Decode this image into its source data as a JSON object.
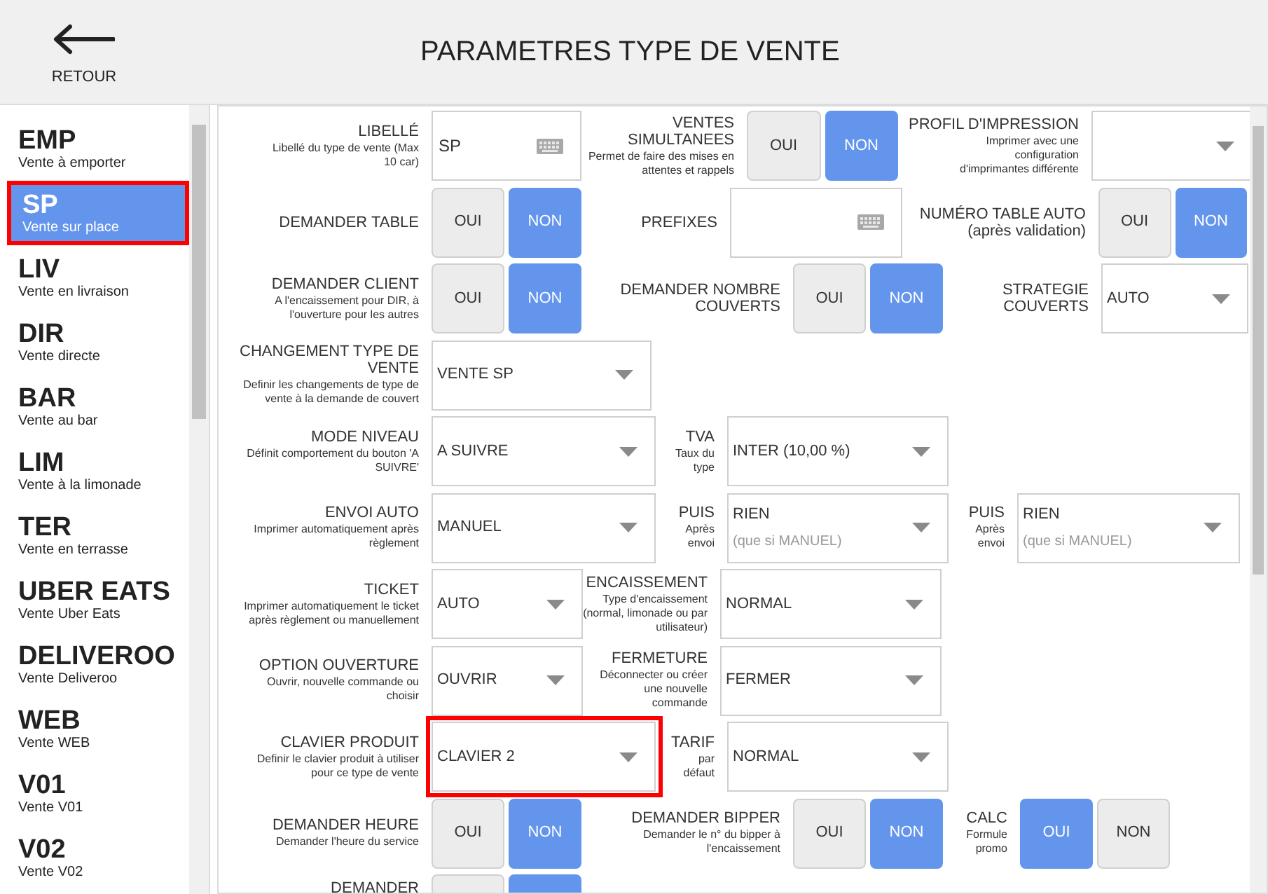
{
  "header": {
    "back_label": "RETOUR",
    "title": "PARAMETRES TYPE DE VENTE"
  },
  "sidebar": {
    "items": [
      {
        "code": "EMP",
        "name": "Vente à emporter",
        "selected": false,
        "highlighted": false
      },
      {
        "code": "SP",
        "name": "Vente sur place",
        "selected": true,
        "highlighted": true
      },
      {
        "code": "LIV",
        "name": "Vente en livraison",
        "selected": false,
        "highlighted": false
      },
      {
        "code": "DIR",
        "name": "Vente directe",
        "selected": false,
        "highlighted": false
      },
      {
        "code": "BAR",
        "name": "Vente au bar",
        "selected": false,
        "highlighted": false
      },
      {
        "code": "LIM",
        "name": "Vente à la limonade",
        "selected": false,
        "highlighted": false
      },
      {
        "code": "TER",
        "name": "Vente en terrasse",
        "selected": false,
        "highlighted": false
      },
      {
        "code": "UBER EATS",
        "name": "Vente Uber Eats",
        "selected": false,
        "highlighted": false
      },
      {
        "code": "DELIVEROO",
        "name": "Vente Deliveroo",
        "selected": false,
        "highlighted": false
      },
      {
        "code": "WEB",
        "name": "Vente WEB",
        "selected": false,
        "highlighted": false
      },
      {
        "code": "V01",
        "name": "Vente V01",
        "selected": false,
        "highlighted": false
      },
      {
        "code": "V02",
        "name": "Vente V02",
        "selected": false,
        "highlighted": false
      }
    ]
  },
  "form": {
    "rows": [
      [
        {
          "kind": "text",
          "label": "LIBELLÉ",
          "hint": "Libellé du type de vente (Max 10 car)",
          "value": "SP"
        },
        {
          "kind": "toggle",
          "label": "VENTES SIMULTANEES",
          "hint": "Permet de faire des mises en attentes et rappels",
          "options": [
            {
              "text": "OUI",
              "selected": false
            },
            {
              "text": "NON",
              "selected": true
            }
          ]
        },
        {
          "kind": "select",
          "label": "PROFIL D'IMPRESSION",
          "hint": "Imprimer avec une configuration d'imprimantes différente"
        }
      ],
      [
        {
          "kind": "toggle",
          "label": "DEMANDER TABLE",
          "options": [
            {
              "text": "OUI",
              "selected": false
            },
            {
              "text": "NON",
              "selected": true
            }
          ]
        },
        {
          "kind": "text",
          "label": "PREFIXES"
        },
        {
          "kind": "toggle",
          "label": "NUMÉRO TABLE AUTO",
          "sublabel": "(après validation)",
          "options": [
            {
              "text": "OUI",
              "selected": false
            },
            {
              "text": "NON",
              "selected": true
            }
          ]
        }
      ],
      [
        {
          "kind": "toggle",
          "label": "DEMANDER CLIENT",
          "hint": "A l'encaissement pour DIR, à l'ouverture pour les autres",
          "options": [
            {
              "text": "OUI",
              "selected": false
            },
            {
              "text": "NON",
              "selected": true
            }
          ]
        },
        {
          "kind": "toggle",
          "label": "DEMANDER NOMBRE COUVERTS",
          "options": [
            {
              "text": "OUI",
              "selected": false
            },
            {
              "text": "NON",
              "selected": true
            }
          ]
        },
        {
          "kind": "select",
          "label": "STRATEGIE COUVERTS",
          "value": "AUTO"
        }
      ],
      [
        {
          "kind": "select",
          "label": "CHANGEMENT TYPE DE VENTE",
          "hint": "Definir les changements de type de vente à la demande de couvert",
          "value": "VENTE SP"
        }
      ],
      [
        {
          "kind": "select",
          "label": "MODE NIVEAU",
          "hint": "Définit comportement du bouton 'A SUIVRE'",
          "value": "A SUIVRE"
        },
        {
          "kind": "select",
          "label": "TVA",
          "hint": "Taux du type",
          "value": "INTER (10,00 %)"
        }
      ],
      [
        {
          "kind": "select",
          "label": "ENVOI AUTO",
          "hint": "Imprimer automatiquement après règlement",
          "value": "MANUEL"
        },
        {
          "kind": "select",
          "label": "PUIS",
          "hint": "Après envoi",
          "value": "RIEN",
          "note": "(que si MANUEL)"
        },
        {
          "kind": "select",
          "label": "PUIS",
          "hint": "Après envoi",
          "value": "RIEN",
          "note": "(que si MANUEL)"
        }
      ],
      [
        {
          "kind": "select",
          "label": "TICKET",
          "hint": "Imprimer automatiquement le ticket après règlement ou manuellement",
          "value": "AUTO"
        },
        {
          "kind": "select",
          "label": "ENCAISSEMENT",
          "hint": "Type d'encaissement (normal, limonade ou par utilisateur)",
          "value": "NORMAL"
        }
      ],
      [
        {
          "kind": "select",
          "label": "OPTION OUVERTURE",
          "hint": "Ouvrir, nouvelle commande ou choisir",
          "value": "OUVRIR"
        },
        {
          "kind": "select",
          "label": "FERMETURE",
          "hint": "Déconnecter ou créer une nouvelle commande",
          "value": "FERMER"
        }
      ],
      [
        {
          "kind": "select",
          "label": "CLAVIER PRODUIT",
          "hint": "Definir le clavier produit à utiliser pour ce type de vente",
          "value": "CLAVIER 2",
          "highlighted": true
        },
        {
          "kind": "select",
          "label": "TARIF",
          "hint": "par défaut",
          "value": "NORMAL"
        }
      ],
      [
        {
          "kind": "toggle",
          "label": "DEMANDER HEURE",
          "hint": "Demander l'heure du service",
          "options": [
            {
              "text": "OUI",
              "selected": false
            },
            {
              "text": "NON",
              "selected": true
            }
          ]
        },
        {
          "kind": "toggle",
          "label": "DEMANDER BIPPER",
          "hint": "Demander le n° du bipper à l'encaissement",
          "options": [
            {
              "text": "OUI",
              "selected": false
            },
            {
              "text": "NON",
              "selected": true
            }
          ]
        },
        {
          "kind": "toggle",
          "label": "CALC",
          "hint": "Formule promo",
          "options": [
            {
              "text": "OUI",
              "selected": true
            },
            {
              "text": "NON",
              "selected": false
            }
          ]
        }
      ],
      [
        {
          "kind": "toggle",
          "label": "DEMANDER",
          "options": [
            {
              "selected": false
            },
            {
              "selected": true
            }
          ]
        }
      ]
    ]
  }
}
